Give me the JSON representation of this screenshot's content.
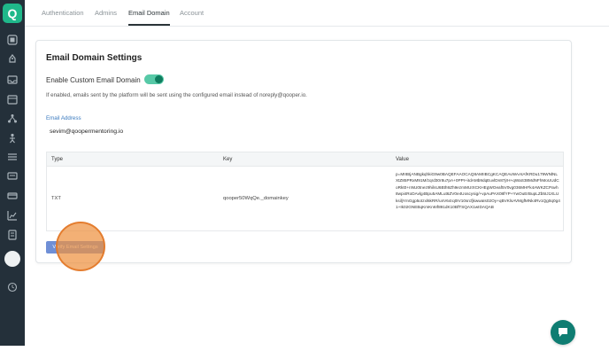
{
  "sidebar": {
    "logo_letter": "Q",
    "icons": [
      "dashboard-icon",
      "rocket-icon",
      "inbox-icon",
      "calendar-icon",
      "network-icon",
      "person-icon",
      "list-icon",
      "message-icon",
      "card-icon",
      "chart-icon",
      "document-icon",
      "clock-icon"
    ]
  },
  "tabs": [
    {
      "label": "Authentication"
    },
    {
      "label": "Admins"
    },
    {
      "label": "Email Domain"
    },
    {
      "label": "Account"
    }
  ],
  "card": {
    "title": "Email Domain Settings",
    "toggle_label": "Enable Custom Email Domain",
    "toggle_on": true,
    "hint": "If enabled, emails sent by the platform will be sent using the configured email instead of noreply@qooper.io.",
    "email_label": "Email Address",
    "email_value": "sevim@qoopermentoring.io"
  },
  "table": {
    "headers": [
      "Type",
      "Key",
      "Value"
    ],
    "rows": [
      {
        "type": "TXT",
        "key": "qooper50WqQe._domainkey",
        "value": "p=MIIBIjANBgkqhkiG9w0BAQEFAAOCAQ8AMIIBCgKCAQEAvWAAtAfKRDu179WNlNLXtZ85PRxM91M/zqrd30r8u7pA+0PPI+iIdAMb9dqEuvlDn87jrH+qWaS38MdNFhMoUUdCoRkt0+nNU0tnez9hilsU6Bth9Zh9ezmMUIXCKHEgWOeaf5V0vg036MHFk4AWKZCPavh8wpi4RoDAvlg4Bpu5AMLut6ZV0e4Uoscysig/+vpAuPAX08fYP+YwOuErBupLZb5IJ1XLUksiljYmGgp5otzxl6kRR/unV64rq0IV10srcfjkwwaIs02Oy+qBVKlsAVMgfMNk4Rv1Qg0q0g41+Ik02GNEBqKmKn6If891dK10BfTSQAX1wIDAQAB"
      }
    ]
  },
  "verify_button_label": "Verify Email Settings",
  "colors": {
    "sidebar": "#24303a",
    "accent": "#1fb88a",
    "button": "#6f8fd6",
    "click_halo": "#ee9240",
    "chat": "#0f7d72"
  }
}
